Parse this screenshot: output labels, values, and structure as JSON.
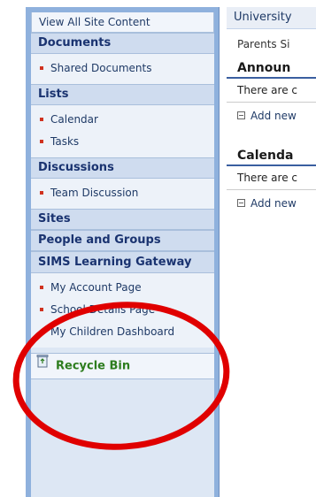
{
  "quick_launch": {
    "view_all": "View All Site Content",
    "sections": [
      {
        "heading": "Documents",
        "items": [
          "Shared Documents"
        ]
      },
      {
        "heading": "Lists",
        "items": [
          "Calendar",
          "Tasks"
        ]
      },
      {
        "heading": "Discussions",
        "items": [
          "Team Discussion"
        ]
      },
      {
        "heading": "Sites",
        "items": []
      },
      {
        "heading": "People and Groups",
        "items": []
      },
      {
        "heading": "SIMS Learning Gateway",
        "items": [
          "My Account Page",
          "School Details Page",
          "My Children Dashboard"
        ]
      }
    ],
    "recycle_bin": "Recycle Bin"
  },
  "content": {
    "breadcrumb": "University",
    "page_title": "Parents Si",
    "web_parts": [
      {
        "title": "Announ",
        "empty_text": "There are c",
        "add_label": "Add new"
      },
      {
        "title": "Calenda",
        "empty_text": "There are c",
        "add_label": "Add new"
      }
    ]
  },
  "colors": {
    "heading_text": "#1a3370",
    "bullet": "#d0321f",
    "recycle_text": "#2d7d1e",
    "annotation": "#e00000"
  },
  "icons": {
    "bullet": "square-bullet-icon",
    "recycle": "recycle-bin-icon",
    "add": "add-new-icon"
  }
}
